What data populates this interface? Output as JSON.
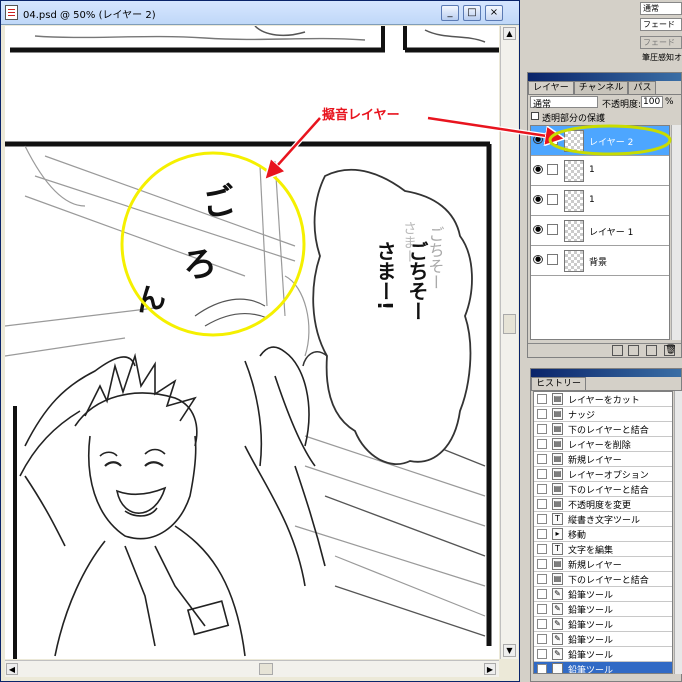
{
  "window": {
    "title": "04.psd @ 50% (レイヤー 2)",
    "min": "_",
    "max": "□",
    "close": "×"
  },
  "manga": {
    "sfx": [
      "ご",
      "ろ",
      "ん"
    ],
    "bubble_line1": "ごちそー",
    "bubble_line2": "さまー!",
    "faint_text1": "ごちそー",
    "faint_text2": "さまー"
  },
  "annotation": {
    "label": "擬音レイヤー"
  },
  "top_right": {
    "blend": "通常",
    "fade": "フェード",
    "fade2": "フェード",
    "pressure": "筆圧感知オ"
  },
  "layers_panel": {
    "tabs": [
      "レイヤー",
      "チャンネル",
      "パス"
    ],
    "blend_mode": "通常",
    "opacity_label": "不透明度:",
    "opacity_value": "100",
    "opacity_unit": "%",
    "lock_label": "透明部分の保護",
    "layers": [
      {
        "name": "レイヤー 2",
        "selected": true
      },
      {
        "name": "1",
        "selected": false
      },
      {
        "name": "1",
        "selected": false
      },
      {
        "name": "レイヤー 1",
        "selected": false
      },
      {
        "name": "背景",
        "selected": false
      }
    ]
  },
  "history_panel": {
    "tab": "ヒストリー",
    "items": [
      {
        "icon": "layer-icon",
        "label": "レイヤーをカット"
      },
      {
        "icon": "layer-icon",
        "label": "ナッジ"
      },
      {
        "icon": "layer-icon",
        "label": "下のレイヤーと結合"
      },
      {
        "icon": "layer-icon",
        "label": "レイヤーを削除"
      },
      {
        "icon": "layer-icon",
        "label": "新規レイヤー"
      },
      {
        "icon": "layer-icon",
        "label": "レイヤーオプション"
      },
      {
        "icon": "layer-icon",
        "label": "下のレイヤーと結合"
      },
      {
        "icon": "layer-icon",
        "label": "不透明度を変更"
      },
      {
        "icon": "type-icon",
        "label": "縦書き文字ツール"
      },
      {
        "icon": "move-icon",
        "label": "移動"
      },
      {
        "icon": "type-icon",
        "label": "文字を編集"
      },
      {
        "icon": "layer-icon",
        "label": "新規レイヤー"
      },
      {
        "icon": "layer-icon",
        "label": "下のレイヤーと結合"
      },
      {
        "icon": "pencil-icon",
        "label": "鉛筆ツール"
      },
      {
        "icon": "pencil-icon",
        "label": "鉛筆ツール"
      },
      {
        "icon": "pencil-icon",
        "label": "鉛筆ツール"
      },
      {
        "icon": "pencil-icon",
        "label": "鉛筆ツール"
      },
      {
        "icon": "pencil-icon",
        "label": "鉛筆ツール"
      },
      {
        "icon": "pencil-icon",
        "label": "鉛筆ツール"
      }
    ]
  },
  "colors": {
    "selection": "#316ac5",
    "layer_selected": "#4da6ff",
    "highlight_circle": "#f5f000",
    "annotation_red": "#e8141e"
  }
}
